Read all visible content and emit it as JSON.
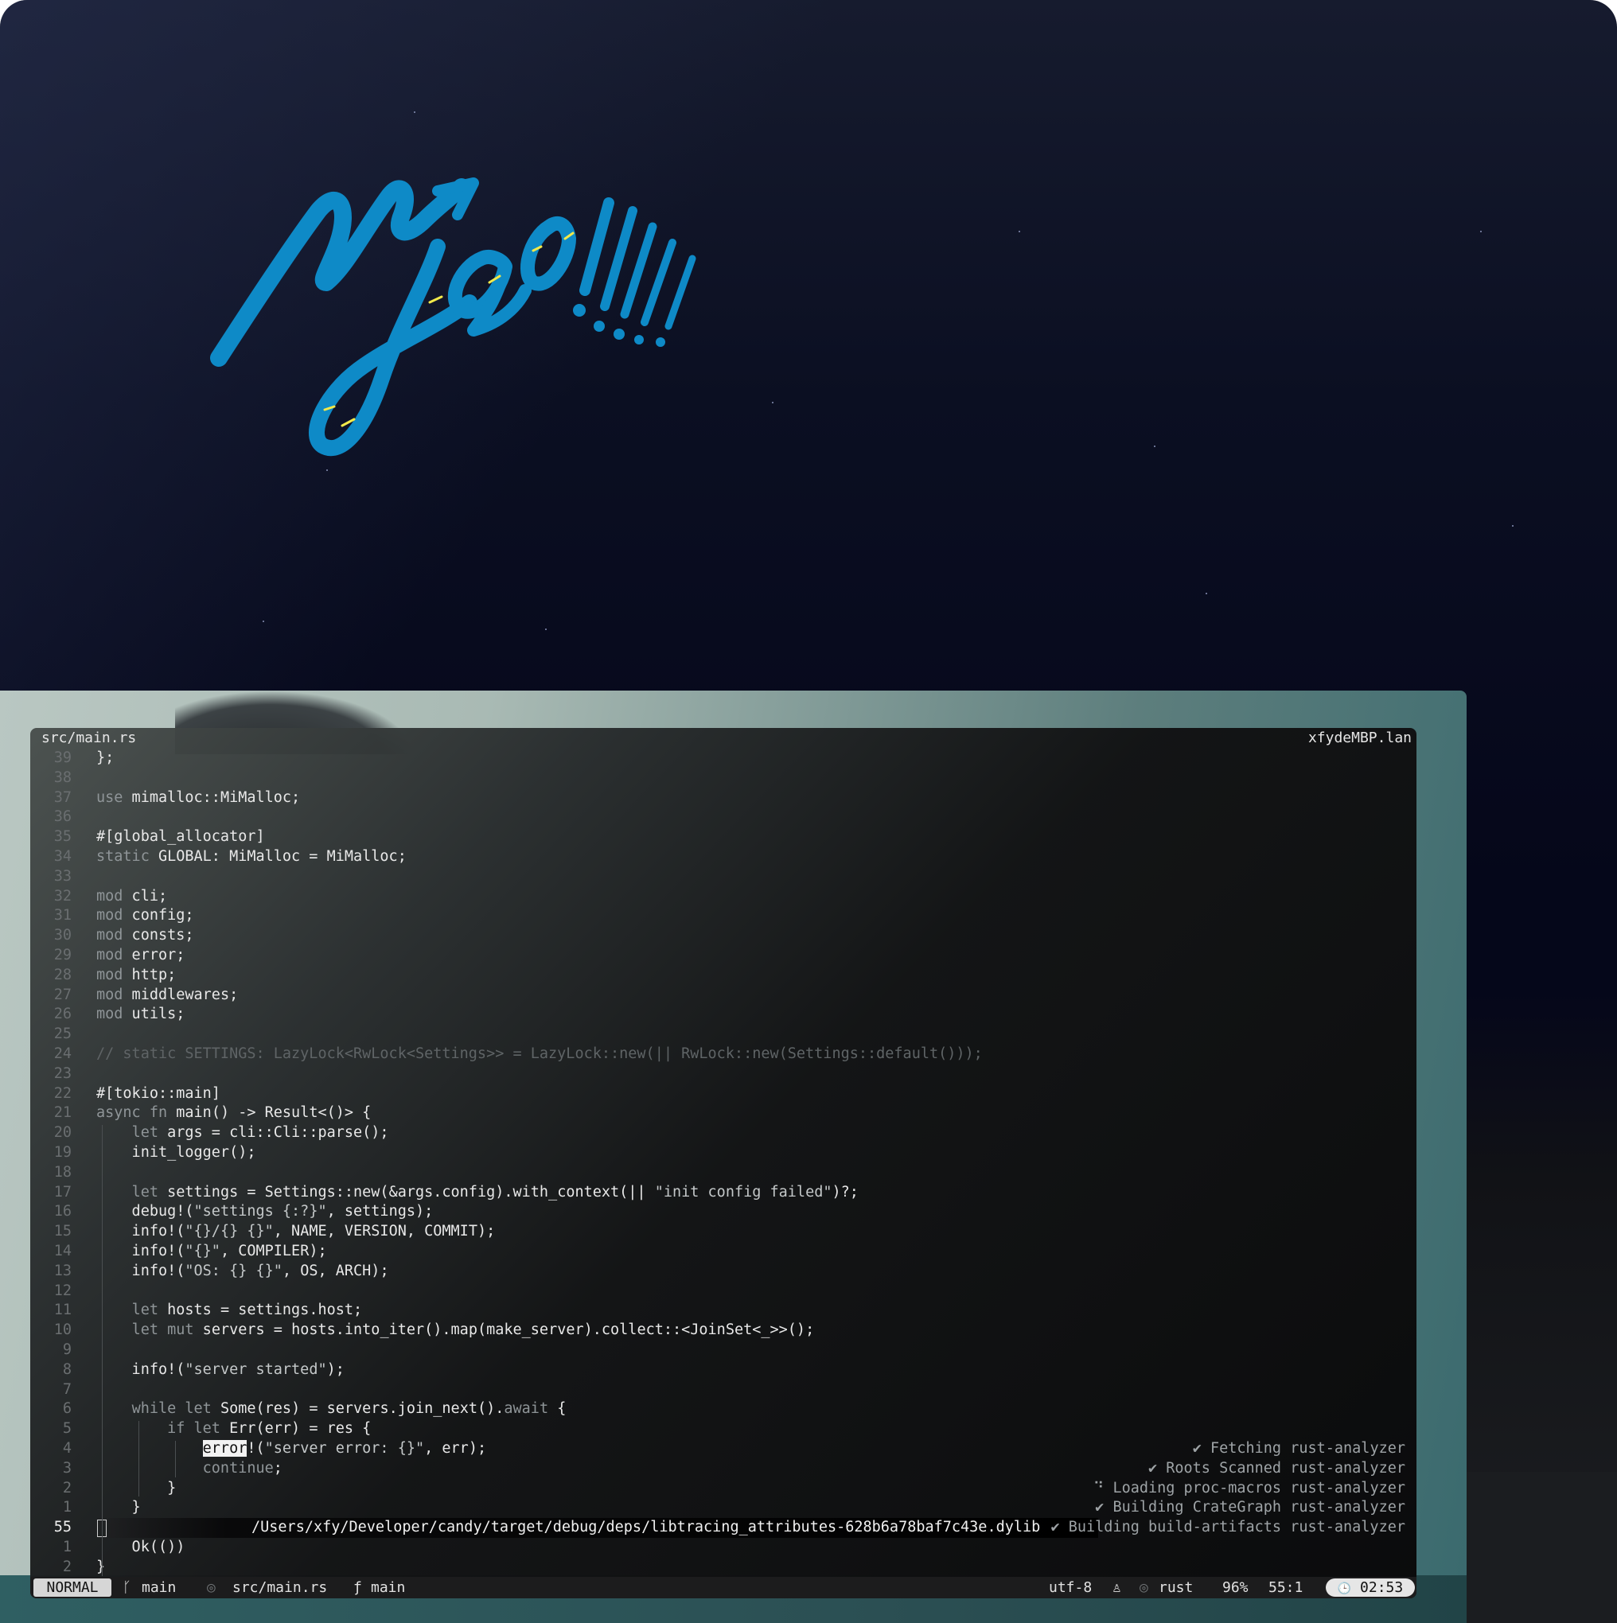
{
  "terminal": {
    "title_left": "src/main.rs",
    "title_right": "xfydeMBP.lan"
  },
  "code_lines": [
    {
      "n": "39",
      "text": "};"
    },
    {
      "n": "38",
      "text": ""
    },
    {
      "n": "37",
      "text": "use mimalloc::MiMalloc;"
    },
    {
      "n": "36",
      "text": ""
    },
    {
      "n": "35",
      "text": "#[global_allocator]"
    },
    {
      "n": "34",
      "text": "static GLOBAL: MiMalloc = MiMalloc;"
    },
    {
      "n": "33",
      "text": ""
    },
    {
      "n": "32",
      "text": "mod cli;"
    },
    {
      "n": "31",
      "text": "mod config;"
    },
    {
      "n": "30",
      "text": "mod consts;"
    },
    {
      "n": "29",
      "text": "mod error;"
    },
    {
      "n": "28",
      "text": "mod http;"
    },
    {
      "n": "27",
      "text": "mod middlewares;"
    },
    {
      "n": "26",
      "text": "mod utils;"
    },
    {
      "n": "25",
      "text": ""
    },
    {
      "n": "24",
      "text": "// static SETTINGS: LazyLock<RwLock<Settings>> = LazyLock::new(|| RwLock::new(Settings::default()));"
    },
    {
      "n": "23",
      "text": ""
    },
    {
      "n": "22",
      "text": "#[tokio::main]"
    },
    {
      "n": "21",
      "text": "async fn main() -> Result<()> {"
    },
    {
      "n": "20",
      "text": "    let args = cli::Cli::parse();"
    },
    {
      "n": "19",
      "text": "    init_logger();"
    },
    {
      "n": "18",
      "text": ""
    },
    {
      "n": "17",
      "text": "    let settings = Settings::new(&args.config).with_context(|| \"init config failed\")?;"
    },
    {
      "n": "16",
      "text": "    debug!(\"settings {:?}\", settings);"
    },
    {
      "n": "15",
      "text": "    info!(\"{}/{} {}\", NAME, VERSION, COMMIT);"
    },
    {
      "n": "14",
      "text": "    info!(\"{}\", COMPILER);"
    },
    {
      "n": "13",
      "text": "    info!(\"OS: {} {}\", OS, ARCH);"
    },
    {
      "n": "12",
      "text": ""
    },
    {
      "n": "11",
      "text": "    let hosts = settings.host;"
    },
    {
      "n": "10",
      "text": "    let mut servers = hosts.into_iter().map(make_server).collect::<JoinSet<_>>();"
    },
    {
      "n": "9",
      "text": ""
    },
    {
      "n": "8",
      "text": "    info!(\"server started\");"
    },
    {
      "n": "7",
      "text": ""
    },
    {
      "n": "6",
      "text": "    while let Some(res) = servers.join_next().await {"
    },
    {
      "n": "5",
      "text": "        if let Err(err) = res {"
    },
    {
      "n": "4",
      "text_pre": "            ",
      "text_hl": "error",
      "text_post": "!(\"server error: {}\", err);"
    },
    {
      "n": "3",
      "text": "            continue;"
    },
    {
      "n": "2",
      "text": "        }"
    },
    {
      "n": "1",
      "text": "    }"
    },
    {
      "n": "55",
      "path": "/Users/xfy/Developer/candy/target/debug/deps/libtracing_attributes-628b6a78baf7c43e.dylib"
    },
    {
      "n": "1",
      "text": "    Ok(())"
    },
    {
      "n": "2",
      "text": "}"
    }
  ],
  "notifications": [
    "✔ Fetching rust-analyzer",
    "✔ Roots Scanned rust-analyzer",
    "⠙ Loading proc-macros rust-analyzer",
    "✔ Building CrateGraph rust-analyzer",
    "✔ Building build-artifacts rust-analyzer"
  ],
  "statusline": {
    "mode": "NORMAL",
    "branch_icon": "ᚴ",
    "branch": "main",
    "file_dot": "◎",
    "file": "src/main.rs",
    "func_icon": "ƒ",
    "func": "main",
    "encoding": "utf-8",
    "os_icon": "♙",
    "lang_dot": "◎",
    "lang": "rust",
    "percent": "96%",
    "position": "55:1",
    "clock_icon": "🕒",
    "time": "02:53"
  },
  "wallpaper": {
    "logo_text": "myGO!!!!!",
    "logo_color": "#0e8ac7",
    "accent_color": "#f2e94a"
  }
}
